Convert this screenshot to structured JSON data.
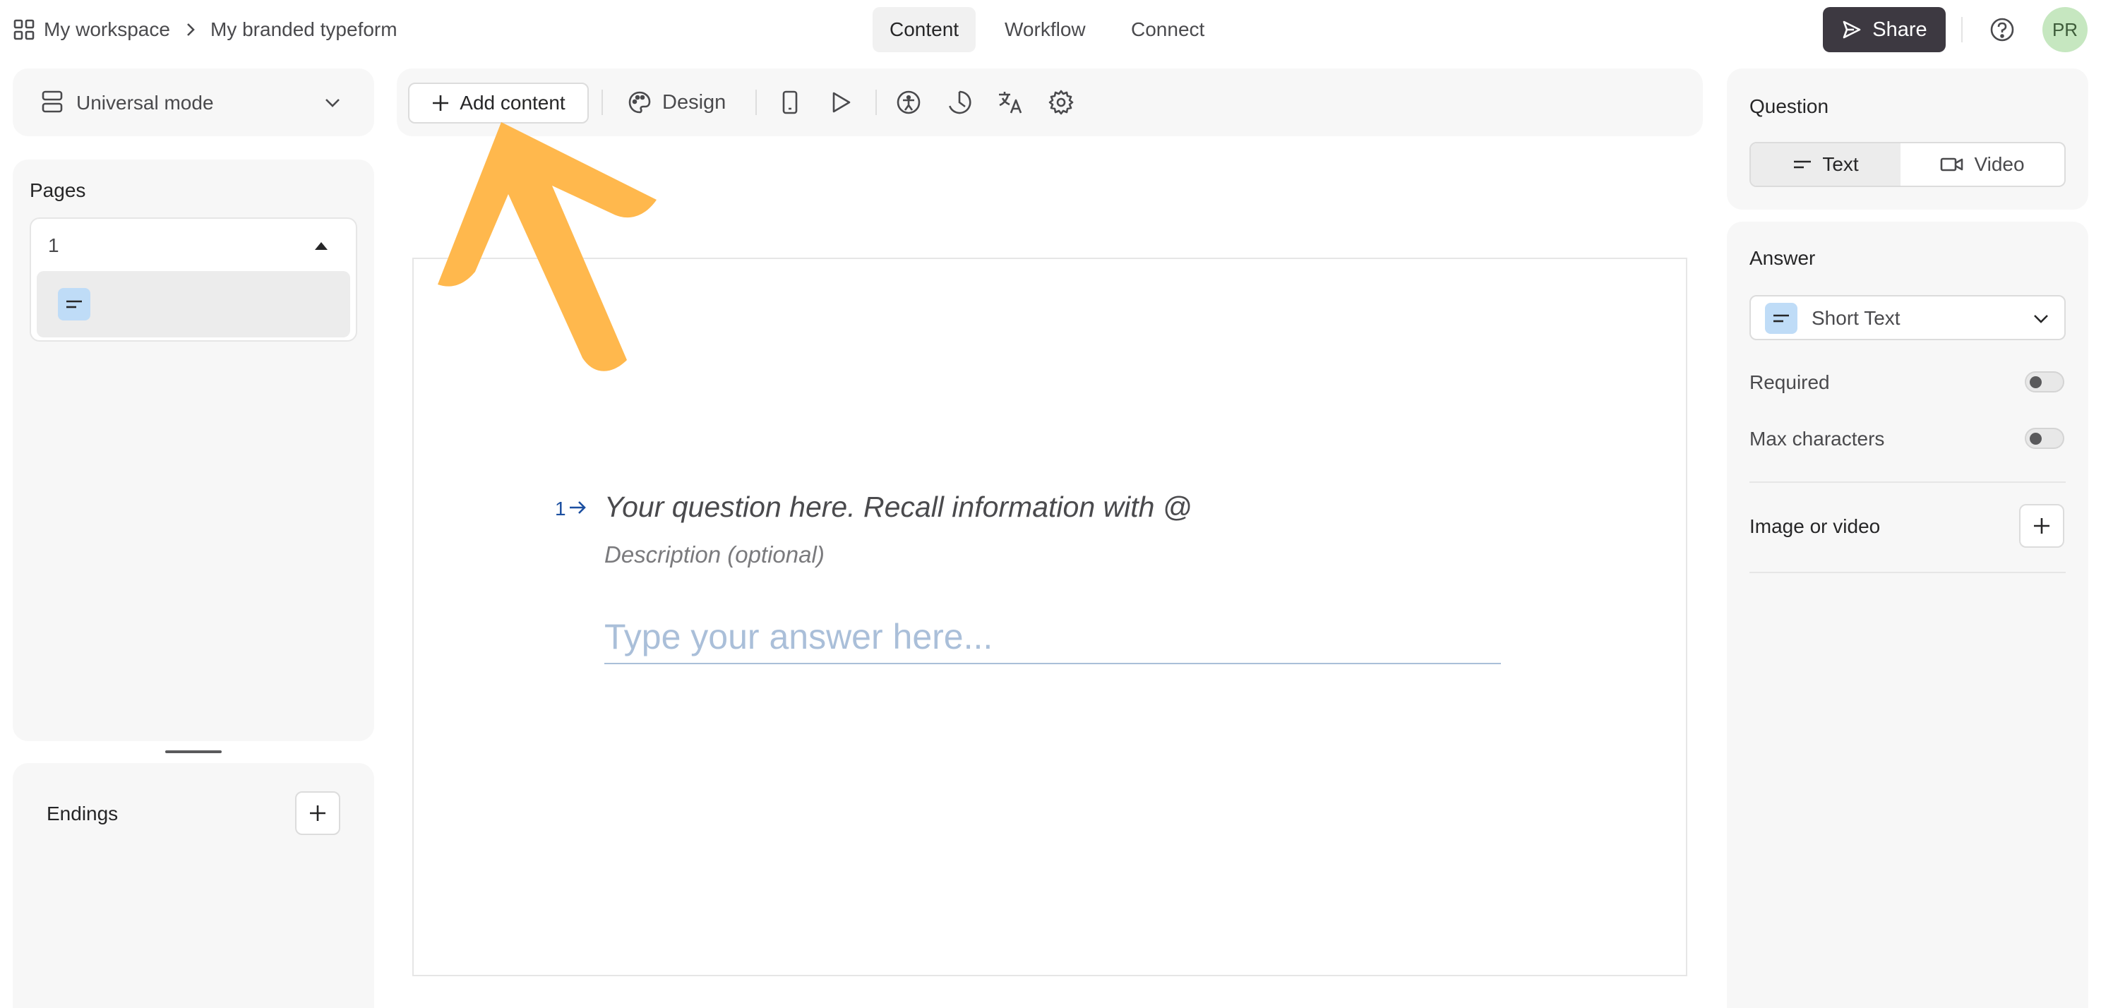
{
  "breadcrumb": {
    "workspace": "My workspace",
    "separator": ">",
    "form_name": "My branded typeform"
  },
  "nav": {
    "tabs": [
      {
        "label": "Content",
        "active": true
      },
      {
        "label": "Workflow",
        "active": false
      },
      {
        "label": "Connect",
        "active": false
      }
    ]
  },
  "header": {
    "share_label": "Share",
    "avatar_initials": "PR"
  },
  "left": {
    "mode_label": "Universal mode",
    "pages_title": "Pages",
    "page_number": "1",
    "endings_title": "Endings"
  },
  "toolbar": {
    "add_content_label": "Add content",
    "design_label": "Design"
  },
  "question": {
    "number": "1",
    "title_placeholder": "Your question here. Recall information with @",
    "description_placeholder": "Description (optional)",
    "answer_placeholder": "Type your answer here..."
  },
  "right": {
    "question_title": "Question",
    "type_text": "Text",
    "type_video": "Video",
    "answer_title": "Answer",
    "answer_type": "Short Text",
    "required_label": "Required",
    "required_on": false,
    "max_chars_label": "Max characters",
    "max_chars_on": false,
    "media_label": "Image or video"
  },
  "colors": {
    "accent_arrow": "#ffb84d",
    "share_bg": "#3d3941",
    "question_number": "#1c4fa0",
    "answer_placeholder": "#aabfd9",
    "short_text_badge": "#bfdcf7",
    "avatar_bg": "#c6e7c0"
  }
}
